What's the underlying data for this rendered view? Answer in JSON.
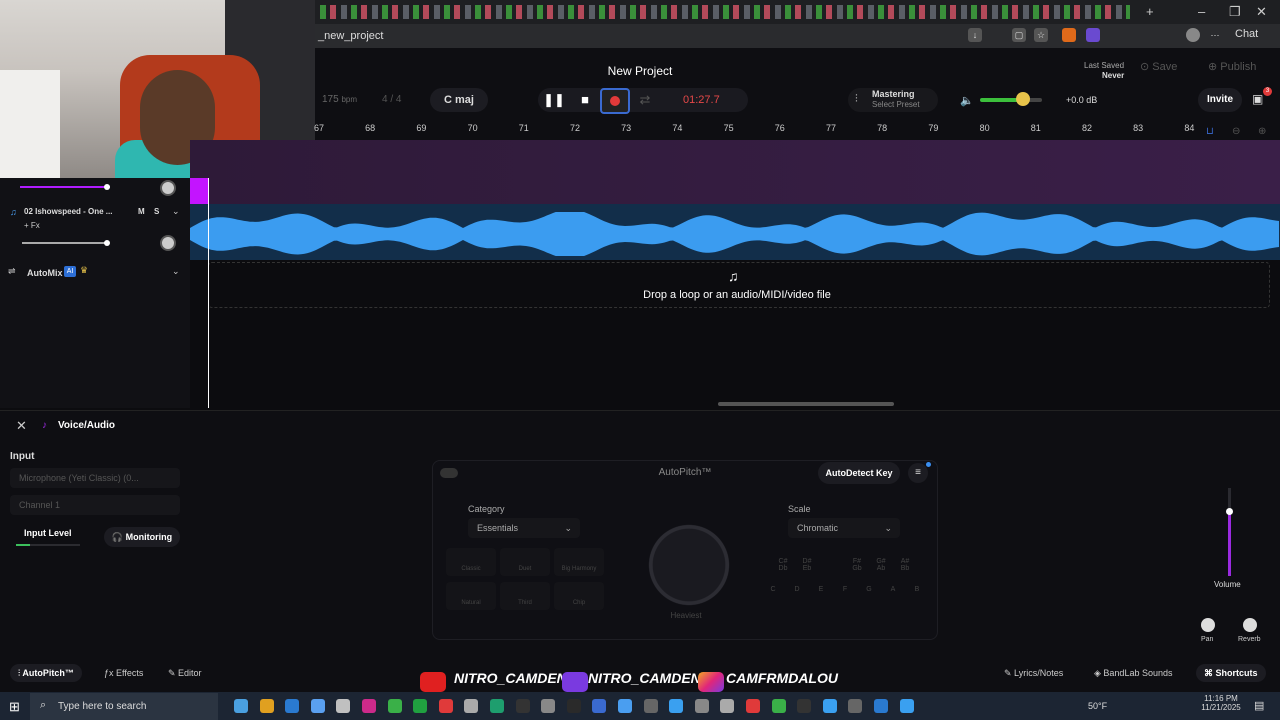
{
  "browser": {
    "url": "_new_project",
    "chat_label": "Chat"
  },
  "transport": {
    "project_title": "New Project",
    "bpm_value": "175",
    "bpm_unit": "bpm",
    "time_signature": "4 / 4",
    "key": "C maj",
    "time": "01:27.7",
    "mastering_title": "Mastering",
    "mastering_sub": "Select Preset",
    "volume_db": "+0.0 dB",
    "volume_level": 0.7,
    "last_saved_label": "Last Saved",
    "last_saved_value": "Never",
    "save_label": "Save",
    "publish_label": "Publish",
    "invite_label": "Invite",
    "cart_badge": "3"
  },
  "ruler": {
    "bars": [
      "67",
      "68",
      "69",
      "70",
      "71",
      "72",
      "73",
      "74",
      "75",
      "76",
      "77",
      "78",
      "79",
      "80",
      "81",
      "82",
      "83",
      "84"
    ]
  },
  "tracks": [
    {
      "name": "02 Ishowspeed - One ...",
      "fx_label": "+ Fx",
      "mute": "M",
      "solo": "S"
    }
  ],
  "automix": {
    "label": "AutoMix",
    "ai_badge": "AI"
  },
  "drop_hint": "Drop a loop or an audio/MIDI/video file",
  "voice_panel": {
    "title": "Voice/Audio",
    "input_label": "Input",
    "device": "Microphone (Yeti Classic) (0...",
    "channel": "Channel 1",
    "input_level_label": "Input Level",
    "monitoring_label": "Monitoring",
    "autopitch_title": "AutoPitch™",
    "autodetect_label": "AutoDetect Key",
    "category_label": "Category",
    "category_value": "Essentials",
    "scale_label": "Scale",
    "scale_value": "Chromatic",
    "dial_label": "Heaviest",
    "presets": [
      "Classic",
      "Duet",
      "Big Harmony",
      "Natural",
      "Third",
      "Chip"
    ],
    "notes_top": [
      "C# Db",
      "D# Eb",
      "F# Gb",
      "G# Ab",
      "A# Bb"
    ],
    "notes_bottom": [
      "C",
      "D",
      "E",
      "F",
      "G",
      "A",
      "B"
    ],
    "volume_label": "Volume",
    "pan_label": "Pan",
    "reverb_label": "Reverb"
  },
  "footer_tabs": {
    "autopitch": "AutoPitch™",
    "effects": "Effects",
    "editor": "Editor",
    "lyrics": "Lyrics/Notes",
    "sounds": "BandLab Sounds",
    "shortcuts": "Shortcuts"
  },
  "social": {
    "youtube": "NITRO_CAMDEN",
    "twitch": "NITRO_CAMDEN",
    "instagram": "CAMFRMDALOU"
  },
  "taskbar": {
    "search_placeholder": "Type here to search",
    "weather": "50°F",
    "time": "11:16 PM",
    "date": "11/21/2025"
  },
  "colors": {
    "accent_purple": "#b01cff",
    "waveform_blue": "#3b9cf0",
    "record_red": "#e23a3a",
    "volume_green": "#3cbf3c"
  }
}
